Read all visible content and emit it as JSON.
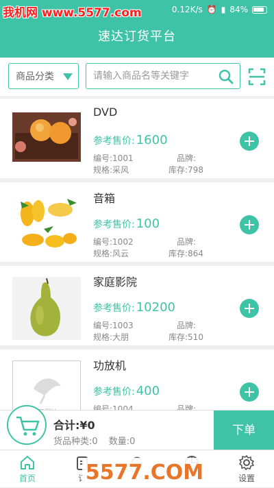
{
  "statusbar": {
    "watermark": "我机网 www.5577.com",
    "speed": "0.12K/s",
    "battery": "84%"
  },
  "header": {
    "title": "速达订货平台"
  },
  "search": {
    "category_label": "商品分类",
    "placeholder": "请输入商品名等关键字"
  },
  "products": [
    {
      "name": "DVD",
      "price_label": "参考售价:",
      "price": "1600",
      "code": "编号:1001",
      "brand": "品牌:",
      "spec": "规格:采风",
      "stock": "库存:798"
    },
    {
      "name": "音箱",
      "price_label": "参考售价:",
      "price": "100",
      "code": "编号:1002",
      "brand": "品牌:",
      "spec": "规格:风云",
      "stock": "库存:864"
    },
    {
      "name": "家庭影院",
      "price_label": "参考售价:",
      "price": "10200",
      "code": "编号:1003",
      "brand": "品牌:",
      "spec": "规格:大朋",
      "stock": "库存:510"
    },
    {
      "name": "功放机",
      "price_label": "参考售价:",
      "price": "400",
      "code": "编号:1004",
      "brand": "品牌:",
      "placeholder_text": "暂无图片"
    }
  ],
  "cart": {
    "total": "合计:¥0",
    "kinds": "货品种类:0",
    "qty": "数量:0",
    "order_label": "下单"
  },
  "tabs": [
    {
      "label": "首页"
    },
    {
      "label": "订"
    },
    {
      "label": ""
    },
    {
      "label": ""
    },
    {
      "label": "设置"
    }
  ],
  "watermark2": "5577.COM",
  "colors": {
    "accent": "#3fc3a6"
  }
}
